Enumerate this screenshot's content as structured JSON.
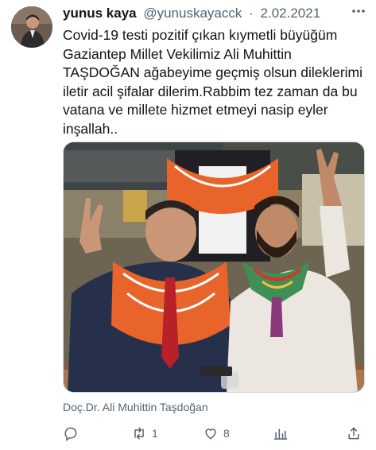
{
  "tweet": {
    "display_name": "yunus kaya",
    "handle": "@yunuskayacck",
    "separator": "·",
    "date": "2.02.2021",
    "more_icon": "more-icon",
    "text": "Covid-19 testi pozitif çıkan kıymetli büyüğüm Gaziantep Millet Vekilimiz Ali Muhittin TAŞDOĞAN ağabeyime geçmiş olsun dileklerimi iletir acil şifalar dilerim.Rabbim tez zaman da bu vatana ve millete hizmet etmeyi nasip eyler inşallah..",
    "photo_tag": "Doç.Dr. Ali Muhittin Taşdoğan"
  },
  "actions": {
    "reply_icon": "reply-icon",
    "retweet_icon": "retweet-icon",
    "retweet_count": "1",
    "like_icon": "heart-icon",
    "like_count": "8",
    "analytics_icon": "analytics-icon",
    "share_icon": "share-icon"
  },
  "colors": {
    "text": "#0f1419",
    "secondary": "#536471",
    "border": "#cfd9de",
    "scarf_orange": "#e8642a"
  }
}
